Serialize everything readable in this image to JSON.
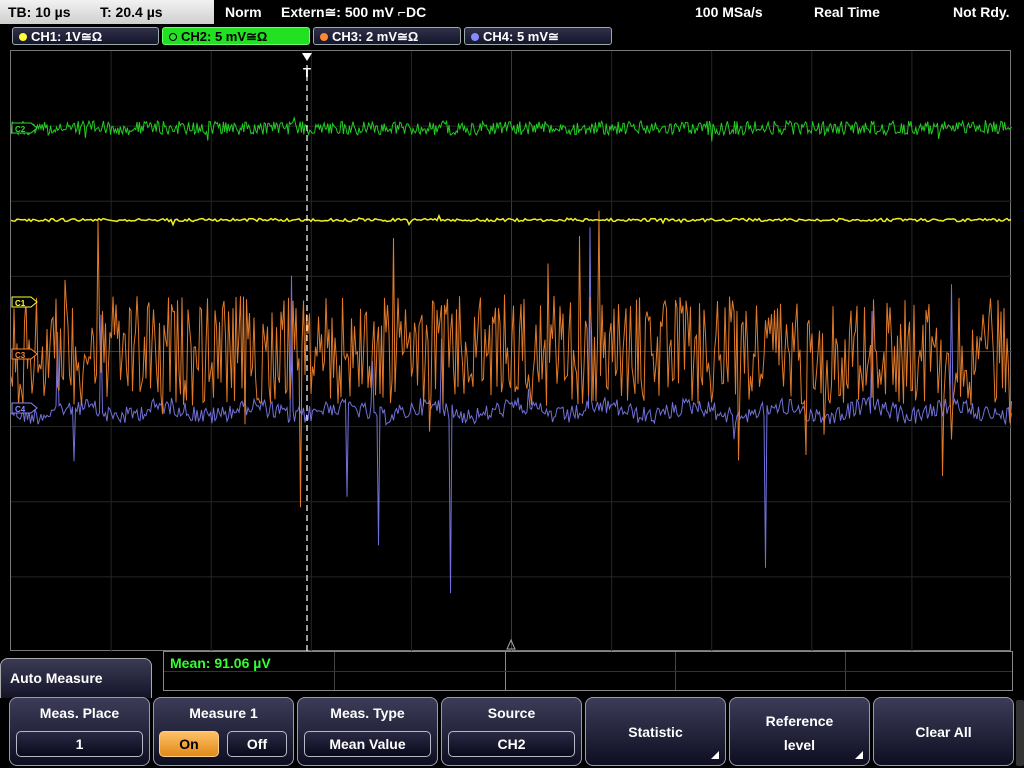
{
  "topbar": {
    "timebase": "TB: 10 µs",
    "trigger_time": "T: 20.4 µs",
    "mode": "Norm",
    "trigger_source": "Extern≅: 500 mV ⌐DC",
    "sample_rate": "100 MSa/s",
    "acq_mode": "Real Time",
    "status": "Not Rdy."
  },
  "channels": [
    {
      "label": "CH1: 1V≅Ω",
      "color": "#ffff33"
    },
    {
      "label": "CH2: 5 mV≅Ω",
      "color": "#33dd33"
    },
    {
      "label": "CH3: 2 mV≅Ω",
      "color": "#ff8833"
    },
    {
      "label": "CH4: 5 mV≅",
      "color": "#8888ff"
    }
  ],
  "markers": {
    "c1": "C1",
    "c2": "C2",
    "c3": "C3",
    "c4": "C4",
    "trigger": "T"
  },
  "result": {
    "text": "Mean: 91.06 µV"
  },
  "menu": {
    "title": "Auto Measure",
    "keys": {
      "meas_place": {
        "label": "Meas. Place",
        "value": "1"
      },
      "measure": {
        "label": "Measure 1",
        "on": "On",
        "off": "Off"
      },
      "meas_type": {
        "label": "Meas. Type",
        "value": "Mean Value"
      },
      "source": {
        "label": "Source",
        "value": "CH2"
      },
      "statistic": {
        "label": "Statistic"
      },
      "reference": {
        "label_line1": "Reference",
        "label_line2": "level"
      },
      "clear": {
        "label": "Clear All"
      }
    }
  }
}
